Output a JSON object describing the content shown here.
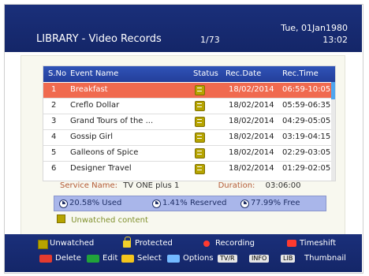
{
  "header": {
    "title": "LIBRARY - Video Records",
    "pager": "1/73",
    "date": "Tue, 01Jan1980",
    "time": "13:02"
  },
  "table": {
    "columns": [
      "S.No",
      "Event Name",
      "Status",
      "Rec.Date",
      "Rec.Time"
    ],
    "rows": [
      {
        "no": "1",
        "name": "Breakfast",
        "status_icon": "unwatched-icon",
        "date": "18/02/2014",
        "time": "06:59-10:05"
      },
      {
        "no": "2",
        "name": "Creflo Dollar",
        "status_icon": "unwatched-icon",
        "date": "18/02/2014",
        "time": "05:59-06:35"
      },
      {
        "no": "3",
        "name": "Grand Tours of the ...",
        "status_icon": "unwatched-icon",
        "date": "18/02/2014",
        "time": "04:29-05:05"
      },
      {
        "no": "4",
        "name": "Gossip Girl",
        "status_icon": "unwatched-icon",
        "date": "18/02/2014",
        "time": "03:19-04:15"
      },
      {
        "no": "5",
        "name": "Galleons of Spice",
        "status_icon": "unwatched-icon",
        "date": "18/02/2014",
        "time": "02:29-03:05"
      },
      {
        "no": "6",
        "name": "Designer Travel",
        "status_icon": "unwatched-icon",
        "date": "18/02/2014",
        "time": "01:29-02:05"
      }
    ]
  },
  "details": {
    "service_label": "Service Name:",
    "service_value": "TV ONE plus 1",
    "duration_label": "Duration:",
    "duration_value": "03:06:00"
  },
  "usage": {
    "used": "20.58% Used",
    "reserved": "1.41% Reserved",
    "free": "77.99% Free"
  },
  "unwatched_text": "Unwatched content",
  "legend": {
    "unwatched": "Unwatched",
    "protected": "Protected",
    "recording": "Recording",
    "timeshift": "Timeshift"
  },
  "actions": {
    "delete": "Delete",
    "edit": "Edit",
    "select": "Select",
    "options": "Options",
    "tvr_key": "TV/R",
    "info_key": "INFO",
    "lib_key": "LIB",
    "thumbnail": "Thumbnail"
  },
  "colors": {
    "header_bg": "#1a2f7a",
    "selected_row": "#f06a4f",
    "table_header": "#2f53b7",
    "usage_bar": "#a9b6ea"
  }
}
